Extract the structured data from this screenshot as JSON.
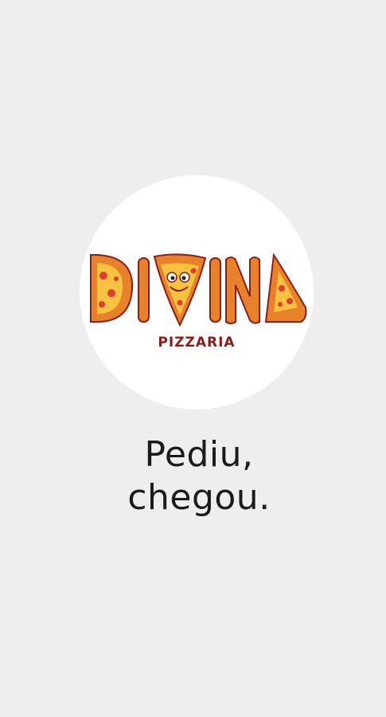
{
  "splash": {
    "logo": {
      "wordmark": "DIVINA",
      "subtitle": "PIZZARIA",
      "icon": "pizza-slice-icon",
      "colors": {
        "crust": "#e8822a",
        "cheese": "#f6c23f",
        "pepperoni": "#e23b32",
        "outline": "#8b1c17"
      }
    },
    "tagline": {
      "line1": "Pediu,",
      "line2": "chegou."
    },
    "background": "#eeeeee"
  }
}
